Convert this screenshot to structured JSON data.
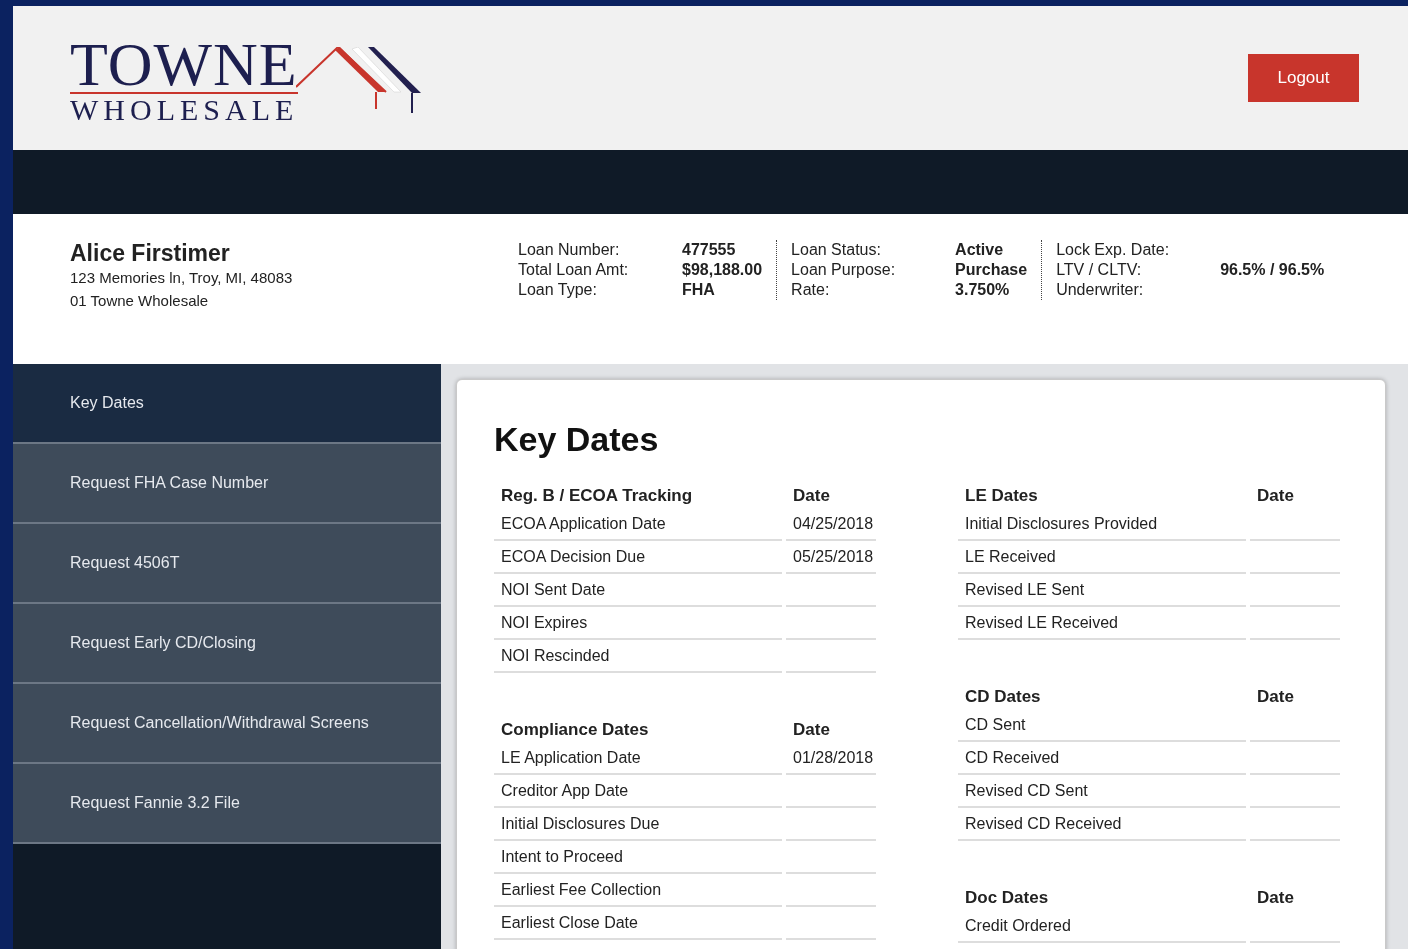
{
  "header": {
    "logo_top": "TOWNE",
    "logo_bottom": "WHOLESALE",
    "logout": "Logout"
  },
  "borrower": {
    "name": "Alice Firstimer",
    "address": "123 Memories ln, Troy, MI, 48083",
    "company": "01 Towne Wholesale"
  },
  "loan_info": [
    [
      {
        "label": "Loan Number:",
        "value": "477555"
      },
      {
        "label": "Total Loan Amt:",
        "value": "$98,188.00"
      },
      {
        "label": "Loan Type:",
        "value": "FHA"
      }
    ],
    [
      {
        "label": "Loan Status:",
        "value": "Active"
      },
      {
        "label": "Loan Purpose:",
        "value": "Purchase"
      },
      {
        "label": "Rate:",
        "value": "3.750%"
      }
    ],
    [
      {
        "label": "Lock Exp. Date:"
      },
      {
        "label": "LTV / CLTV:",
        "value": "96.5% / 96.5%"
      },
      {
        "label": "Underwriter:"
      }
    ]
  ],
  "sidebar": {
    "items": [
      {
        "label": "Key Dates",
        "selected": true
      },
      {
        "label": "Request FHA Case Number",
        "selected": false
      },
      {
        "label": "Request 4506T",
        "selected": false
      },
      {
        "label": "Request Early CD/Closing",
        "selected": false
      },
      {
        "label": "Request Cancellation/Withdrawal Screens",
        "selected": false
      },
      {
        "label": "Request Fannie 3.2 File",
        "selected": false
      }
    ]
  },
  "main": {
    "title": "Key Dates",
    "left_tables": [
      {
        "title": "Reg. B / ECOA Tracking",
        "date_heading": "Date",
        "rows": [
          {
            "label": "ECOA Application Date",
            "date": "04/25/2018"
          },
          {
            "label": "ECOA Decision Due",
            "date": "05/25/2018"
          },
          {
            "label": "NOI Sent Date"
          },
          {
            "label": "NOI Expires"
          },
          {
            "label": "NOI Rescinded"
          }
        ]
      },
      {
        "title": "Compliance Dates",
        "date_heading": "Date",
        "rows": [
          {
            "label": "LE Application Date",
            "date": "01/28/2018"
          },
          {
            "label": "Creditor App Date"
          },
          {
            "label": "Initial Disclosures Due"
          },
          {
            "label": "Intent to Proceed"
          },
          {
            "label": "Earliest Fee Collection"
          },
          {
            "label": "Earliest Close Date"
          }
        ]
      }
    ],
    "right_tables": [
      {
        "title": "LE Dates",
        "date_heading": "Date",
        "rows": [
          {
            "label": "Initial Disclosures Provided"
          },
          {
            "label": "LE Received"
          },
          {
            "label": "Revised LE Sent"
          },
          {
            "label": "Revised LE Received"
          }
        ]
      },
      {
        "title": "CD Dates",
        "date_heading": "Date",
        "rows": [
          {
            "label": "CD Sent"
          },
          {
            "label": "CD Received"
          },
          {
            "label": "Revised CD Sent"
          },
          {
            "label": "Revised CD Received"
          }
        ]
      },
      {
        "title": "Doc Dates",
        "date_heading": "Date",
        "rows": [
          {
            "label": "Credit Ordered"
          }
        ]
      }
    ]
  }
}
